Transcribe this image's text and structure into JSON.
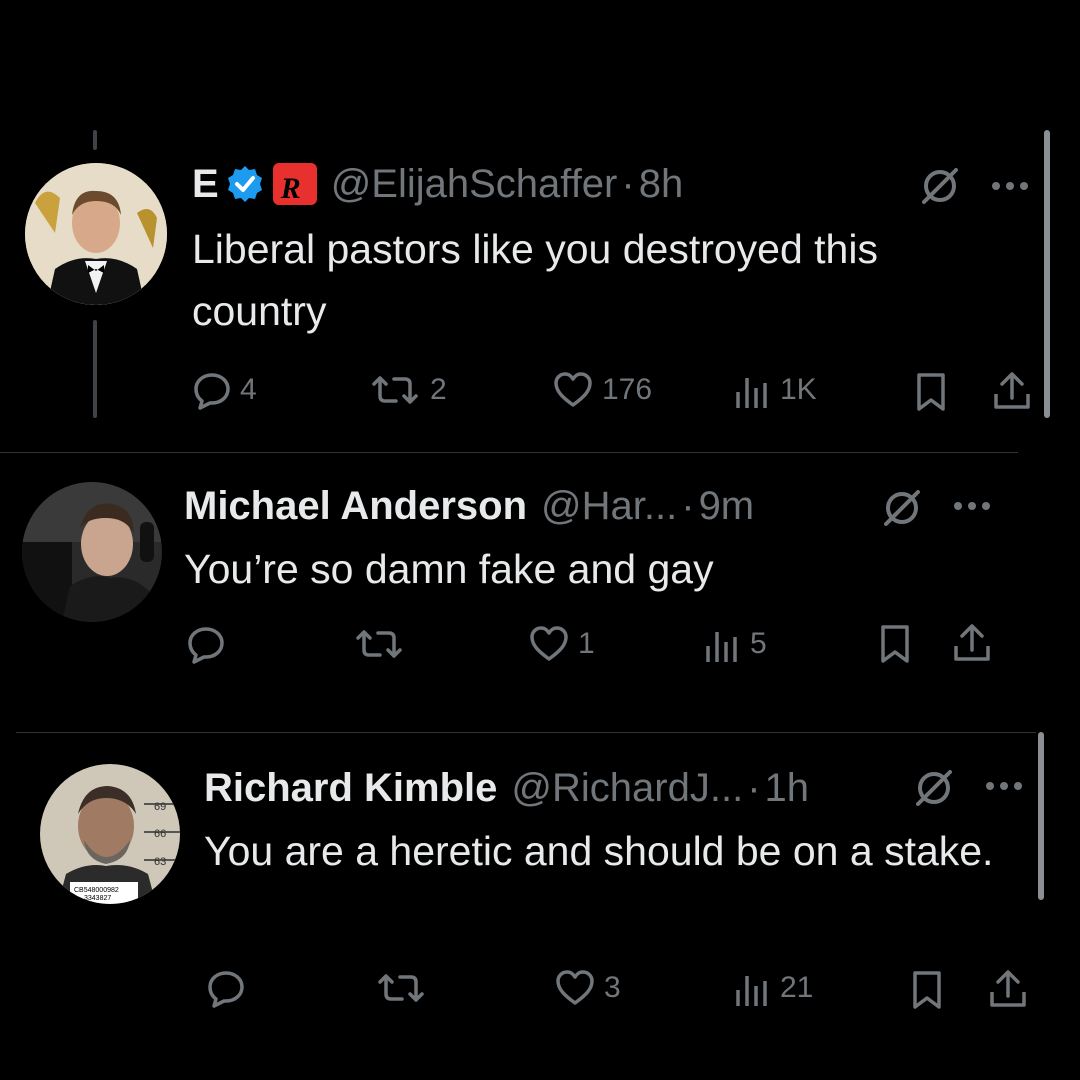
{
  "tweets": [
    {
      "name": "E",
      "handle": "@ElijahSchaffer",
      "dot": "·",
      "time": "8h",
      "text": "Liberal pastors like you destroyed this country",
      "replies": "4",
      "reposts": "2",
      "likes": "176",
      "views": "1K"
    },
    {
      "name": "Michael Anderson",
      "handle": "@Har...",
      "dot": "·",
      "time": "9m",
      "text": "You’re so damn fake and gay",
      "replies": "",
      "reposts": "",
      "likes": "1",
      "views": "5"
    },
    {
      "name": "Richard Kimble",
      "handle": "@RichardJ...",
      "dot": "·",
      "time": "1h",
      "text": "You are a heretic and should be on a stake.",
      "replies": "",
      "reposts": "",
      "likes": "3",
      "views": "21",
      "avatar_text": [
        "69",
        "66",
        "63",
        "CB548000982",
        "3343827"
      ]
    }
  ],
  "icons": {
    "verified": "verified-badge-icon",
    "rtv": "rtv-badge-icon",
    "grok": "grok-icon",
    "more": "more-icon",
    "reply": "reply-icon",
    "repost": "repost-icon",
    "like": "heart-icon",
    "views": "views-icon",
    "bookmark": "bookmark-icon",
    "share": "share-icon"
  },
  "colors": {
    "background": "#000000",
    "text": "#e7e9ea",
    "muted": "#71767b",
    "verified": "#1d9bf0",
    "rtv": "#e8312f"
  }
}
